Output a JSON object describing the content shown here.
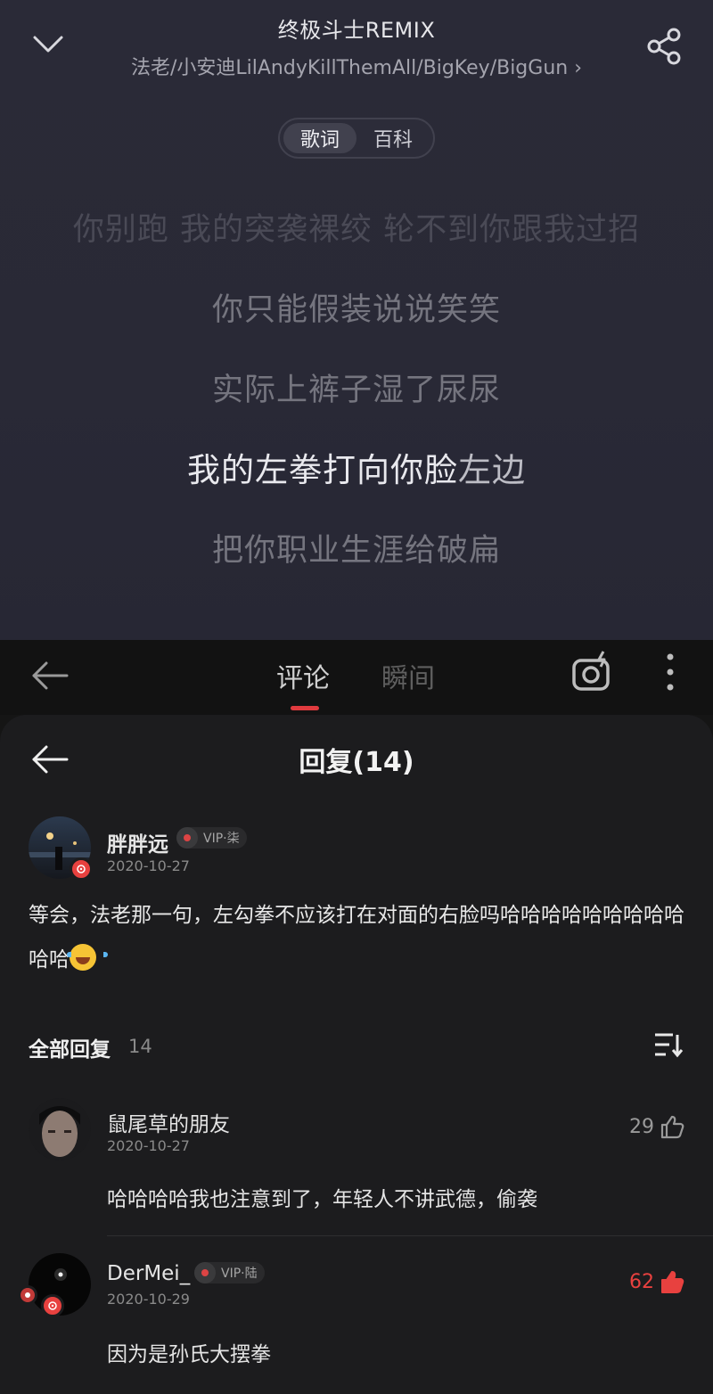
{
  "player": {
    "song_title": "终极斗士REMIX",
    "artists": "法老/小安迪LilAndyKillThemAll/BigKey/BigGun",
    "artists_chevron": "›",
    "tabs": [
      {
        "label": "歌词",
        "active": true
      },
      {
        "label": "百科",
        "active": false
      }
    ],
    "lyrics": [
      {
        "text": "你别跑 我的突袭裸绞 轮不到你跟我过招",
        "state": "dim"
      },
      {
        "text": "你只能假装说说笑笑",
        "state": "normal"
      },
      {
        "text": "实际上裤子湿了尿尿",
        "state": "normal"
      },
      {
        "sung": "我的左拳打向你脸",
        "rest": "左边",
        "state": "current"
      },
      {
        "text": "把你职业生涯给破扁",
        "state": "normal"
      }
    ]
  },
  "comment_bar": {
    "tab_comments": "评论",
    "tab_moments": "瞬间"
  },
  "sheet": {
    "title": "回复(14)",
    "main_comment": {
      "username": "胖胖远",
      "vip_label": "VIP·柒",
      "date": "2020-10-27",
      "text": "等会，法老那一句，左勾拳不应该打在对面的右脸吗哈哈哈哈哈哈哈哈哈哈哈"
    },
    "all_replies_label": "全部回复",
    "all_replies_count": "14",
    "replies": [
      {
        "username": "鼠尾草的朋友",
        "date": "2020-10-27",
        "likes": "29",
        "liked": false,
        "text": "哈哈哈哈我也注意到了，年轻人不讲武德，偷袭"
      },
      {
        "username": "DerMei_",
        "vip_label": "VIP·陆",
        "date": "2020-10-29",
        "likes": "62",
        "liked": true,
        "text": "因为是孙氏大摆拳"
      }
    ]
  },
  "colors": {
    "accent_red": "#e8413f",
    "player_bg": "#2a2a37",
    "sheet_bg": "#1c1c1e"
  },
  "icons": [
    "chevron-down-icon",
    "share-icon",
    "back-arrow-icon",
    "camera-icon",
    "more-vertical-icon",
    "sort-icon",
    "thumbs-up-icon",
    "vinyl-disc-icon"
  ]
}
